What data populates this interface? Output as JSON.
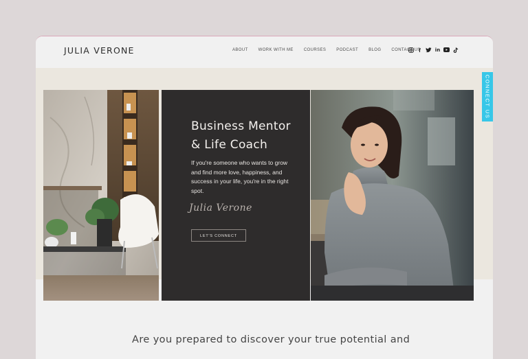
{
  "site": {
    "brand": "JULIA VERONE"
  },
  "nav": {
    "items": [
      {
        "label": "ABOUT"
      },
      {
        "label": "WORK WITH ME"
      },
      {
        "label": "COURSES"
      },
      {
        "label": "PODCAST"
      },
      {
        "label": "BLOG"
      },
      {
        "label": "CONTACT US"
      }
    ]
  },
  "social": [
    {
      "icon": "instagram-icon",
      "glyph": "◎"
    },
    {
      "icon": "facebook-icon",
      "glyph": "f"
    },
    {
      "icon": "twitter-icon",
      "glyph": "🐦"
    },
    {
      "icon": "linkedin-icon",
      "glyph": "in"
    },
    {
      "icon": "youtube-icon",
      "glyph": "▶"
    },
    {
      "icon": "tiktok-icon",
      "glyph": "♪"
    }
  ],
  "hero": {
    "heading_line1": "Business Mentor",
    "heading_line2": "& Life Coach",
    "lede": "If you're someone who wants to grow and find more love, happiness, and success in your life, you're in the right spot.",
    "signature": "Julia Verone",
    "cta_label": "LET'S CONNECT"
  },
  "side_tab": {
    "label": "CONNECT US"
  },
  "section": {
    "heading": "Are you prepared to discover your true potential and"
  },
  "colors": {
    "dark_panel": "#2e2c2c",
    "accent_tab": "#37c7e8",
    "band": "#ebe7df"
  }
}
